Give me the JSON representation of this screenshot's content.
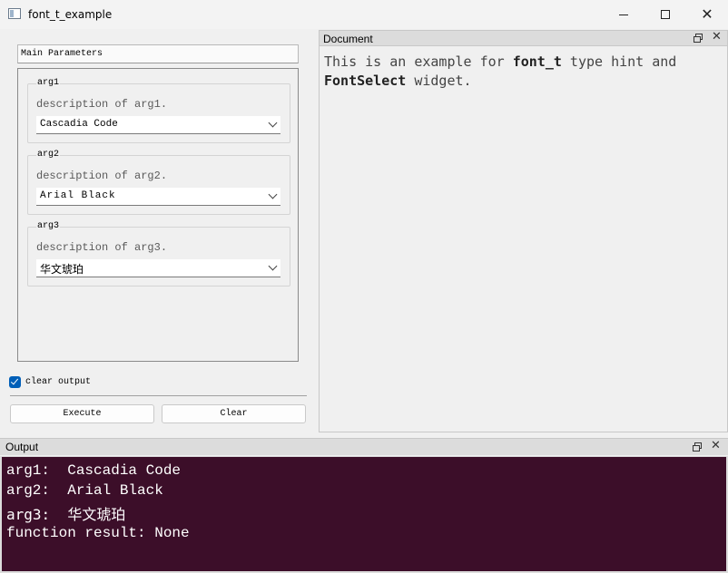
{
  "window": {
    "title": "font_t_example",
    "minimize_icon": "minimize-icon",
    "maximize_icon": "maximize-icon",
    "close_glyph": "✕"
  },
  "params": {
    "header": "Main Parameters",
    "args": [
      {
        "legend": "arg1",
        "description": "description of arg1.",
        "value": "Cascadia Code"
      },
      {
        "legend": "arg2",
        "description": "description of arg2.",
        "value": "Arial Black"
      },
      {
        "legend": "arg3",
        "description": "description of arg3.",
        "value": "华文琥珀"
      }
    ],
    "clear_output_label": "clear output",
    "clear_output_checked": true,
    "execute_label": "Execute",
    "clear_label": "Clear"
  },
  "document": {
    "title": "Document",
    "text_1": "This is an example for ",
    "bold_1": "font_t",
    "text_2": " type hint and ",
    "bold_2": "FontSelect",
    "text_3": " widget.",
    "close_glyph": "✕"
  },
  "output": {
    "title": "Output",
    "close_glyph": "✕",
    "lines": [
      "arg1:  Cascadia Code",
      "arg2:  Arial Black",
      "arg3:  华文琥珀",
      "function result: None"
    ]
  },
  "colors": {
    "output_bg": "#3c0e29",
    "checkbox_accent": "#005fb8"
  }
}
